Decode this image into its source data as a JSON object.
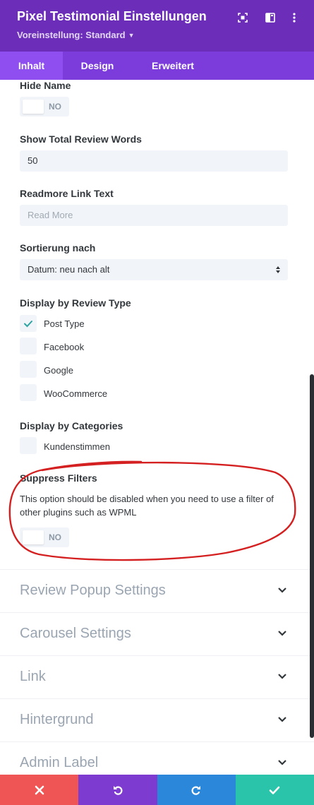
{
  "header": {
    "title": "Pixel Testimonial Einstellungen",
    "preset": "Voreinstellung: Standard",
    "icons": [
      "expand-icon",
      "sidebar-icon",
      "more-icon"
    ]
  },
  "tabs": [
    {
      "label": "Inhalt",
      "active": true
    },
    {
      "label": "Design",
      "active": false
    },
    {
      "label": "Erweitert",
      "active": false
    }
  ],
  "settings": {
    "hide_name": {
      "label": "Hide Name",
      "toggle": "NO"
    },
    "total_words": {
      "label": "Show Total Review Words",
      "value": "50"
    },
    "readmore": {
      "label": "Readmore Link Text",
      "placeholder": "Read More"
    },
    "sort": {
      "label": "Sortierung nach",
      "value": "Datum: neu nach alt"
    },
    "review_type": {
      "label": "Display by Review Type",
      "options": [
        {
          "label": "Post Type",
          "checked": true
        },
        {
          "label": "Facebook",
          "checked": false
        },
        {
          "label": "Google",
          "checked": false
        },
        {
          "label": "WooCommerce",
          "checked": false
        }
      ]
    },
    "categories": {
      "label": "Display by Categories",
      "options": [
        {
          "label": "Kundenstimmen",
          "checked": false
        }
      ]
    },
    "suppress": {
      "label": "Suppress Filters",
      "description": "This option should be disabled when you need to use a filter of other plugins such as WPML",
      "toggle": "NO"
    }
  },
  "sections": [
    {
      "label": "Review Popup Settings"
    },
    {
      "label": "Carousel Settings"
    },
    {
      "label": "Link"
    },
    {
      "label": "Hintergrund"
    },
    {
      "label": "Admin Label"
    }
  ],
  "footer": {
    "buttons": [
      {
        "name": "cancel",
        "icon": "close-icon",
        "color": "#ef5555"
      },
      {
        "name": "undo",
        "icon": "undo-icon",
        "color": "#7e3bd0"
      },
      {
        "name": "redo",
        "icon": "redo-icon",
        "color": "#2b87da"
      },
      {
        "name": "save",
        "icon": "check-icon",
        "color": "#29c4a9"
      }
    ]
  },
  "colors": {
    "header": "#6c2eb9",
    "tabs": "#7b3cdb",
    "active_tab": "#8f4ef0",
    "annotation": "#d42020"
  }
}
